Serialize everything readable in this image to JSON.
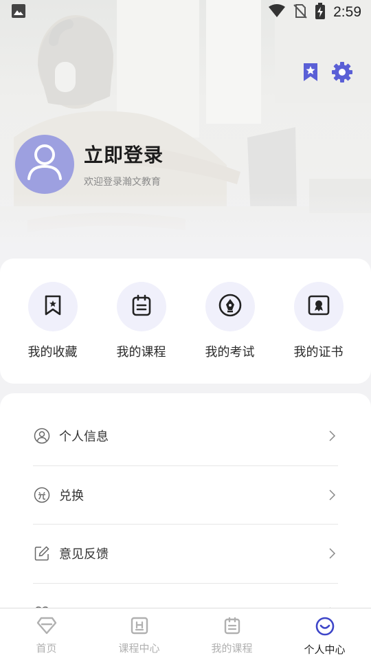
{
  "status_bar": {
    "time": "2:59",
    "icons": [
      "image-notification-icon",
      "wifi-icon",
      "no-sim-icon",
      "battery-charging-icon"
    ]
  },
  "header": {
    "actions": [
      "bookmark-star-icon",
      "gear-icon"
    ],
    "login_title": "立即登录",
    "login_subtitle": "欢迎登录瀚文教育"
  },
  "shortcuts": [
    {
      "label": "我的收藏",
      "icon": "bookmark-star-icon"
    },
    {
      "label": "我的课程",
      "icon": "notebook-icon"
    },
    {
      "label": "我的考试",
      "icon": "pen-nib-icon"
    },
    {
      "label": "我的证书",
      "icon": "certificate-icon"
    }
  ],
  "menu": [
    {
      "label": "个人信息",
      "icon": "user-circle-icon"
    },
    {
      "label": "兑换",
      "icon": "exchange-icon"
    },
    {
      "label": "意见反馈",
      "icon": "edit-icon"
    },
    {
      "label": "",
      "icon": "heart-hands-icon"
    }
  ],
  "bottom_nav": [
    {
      "label": "首页",
      "icon": "home-diamond-icon",
      "active": false
    },
    {
      "label": "课程中心",
      "icon": "course-center-icon",
      "active": false
    },
    {
      "label": "我的课程",
      "icon": "notebook-icon",
      "active": false
    },
    {
      "label": "个人中心",
      "icon": "smile-icon",
      "active": true
    }
  ],
  "colors": {
    "accent": "#5a5fd6",
    "avatar_bg": "#9da0e0",
    "shortcut_bg": "#f0f0fb",
    "inactive_nav": "#b0b0b0"
  }
}
